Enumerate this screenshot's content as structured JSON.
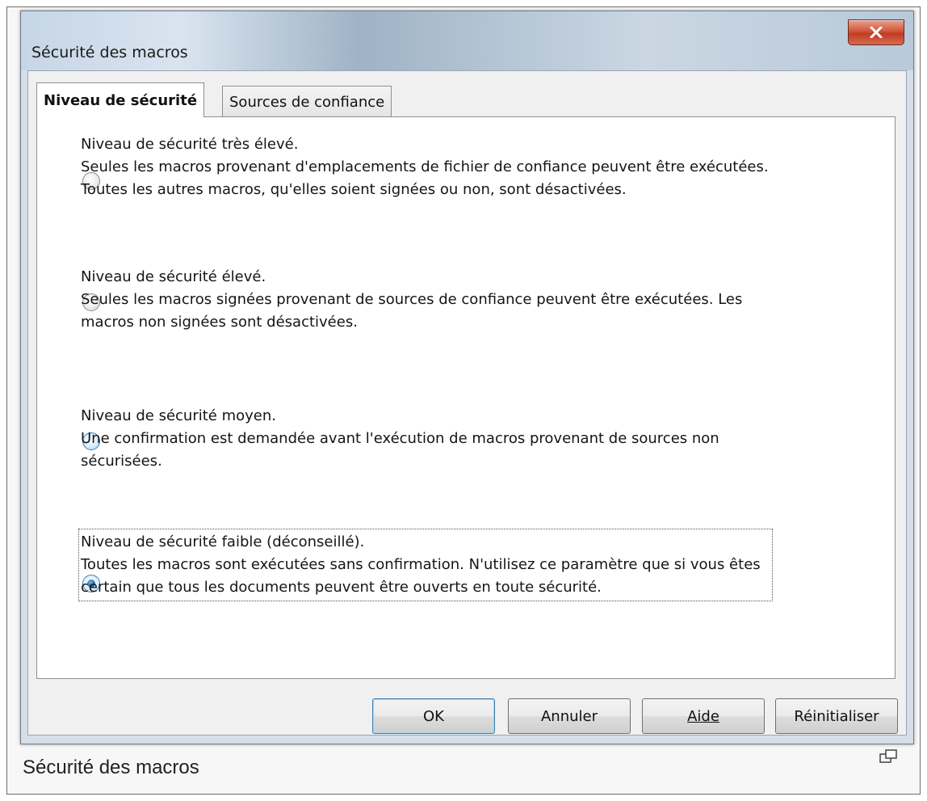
{
  "window": {
    "title": "Sécurité des macros"
  },
  "tabs": [
    {
      "label": "Niveau de sécurité",
      "active": true
    },
    {
      "label": "Sources de confiance",
      "active": false
    }
  ],
  "options": [
    {
      "title": "Niveau de sécurité très élevé.",
      "description": "Seules les macros provenant d'emplacements de fichier de confiance peuvent être exécutées. Toutes les autres macros, qu'elles soient signées ou non, sont désactivées.",
      "selected": false
    },
    {
      "title": "Niveau de sécurité élevé.",
      "description": "Seules les macros signées provenant de sources de confiance peuvent être exécutées. Les macros non signées sont désactivées.",
      "selected": false
    },
    {
      "title": "Niveau de sécurité moyen.",
      "description": "Une confirmation est demandée avant l'exécution de macros provenant de sources non sécurisées.",
      "selected": false
    },
    {
      "title": "Niveau de sécurité faible (déconseillé).",
      "description": "Toutes les macros sont exécutées sans confirmation. N'utilisez ce paramètre que si vous êtes certain que tous les documents peuvent être ouverts en toute sécurité.",
      "selected": true
    }
  ],
  "buttons": {
    "ok": "OK",
    "cancel": "Annuler",
    "help": "Aide",
    "reset": "Réinitialiser"
  },
  "caption": "Sécurité des macros",
  "icons": {
    "close": "close-icon",
    "expand": "expand-icon"
  },
  "colors": {
    "accent": "#3c7fb1",
    "close_button": "#c8482c"
  }
}
